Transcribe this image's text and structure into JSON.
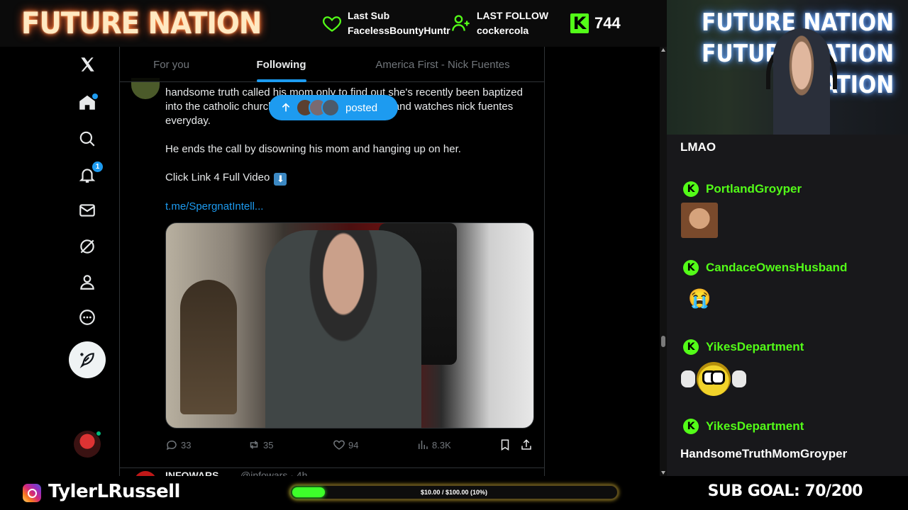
{
  "overlay": {
    "brand": "FUTURE NATION",
    "last_sub_label": "Last Sub",
    "last_sub_name": "FacelessBountyHuntr",
    "last_follow_label": "LAST FOLLOW",
    "last_follow_name": "cockercola",
    "kick_logo": "K",
    "viewer_count": "744",
    "accent_color": "#53fc18",
    "instagram_handle": "TylerLRussell",
    "goal_text": "$10.00 / $100.00 (10%)",
    "goal_progress_percent": 10,
    "sub_goal": "SUB GOAL: 70/200"
  },
  "webcam": {
    "neon_lines": [
      "FUTURE NATION",
      "FUTURE NATION",
      "NATION"
    ]
  },
  "x_app": {
    "nav_icons": [
      "x-logo-icon",
      "home-icon",
      "search-icon",
      "notifications-icon",
      "messages-icon",
      "grok-icon",
      "profile-icon",
      "more-icon",
      "post-icon"
    ],
    "notification_count": "1",
    "tabs": [
      {
        "label": "For you",
        "active": false
      },
      {
        "label": "Following",
        "active": true
      },
      {
        "label": "America First - Nick Fuentes",
        "active": false
      }
    ],
    "new_posts_pill": "posted",
    "tweet": {
      "line1": "handsome truth called his mom only to find out she's recently been baptized into the catholic church, repented for racist sins, and watches nick fuentes everyday.",
      "line2": "He ends the call by disowning his mom and hanging up on her.",
      "line3": "Click Link 4 Full Video",
      "link": "t.me/SpergnatIntell...",
      "replies": "33",
      "reposts": "35",
      "likes": "94",
      "views": "8.3K"
    },
    "next_tweet_name": "INFOWARS",
    "next_tweet_handle": "@infowars · 4h"
  },
  "chat": {
    "messages": [
      {
        "user": "",
        "text": "LMAO"
      },
      {
        "user": "PortlandGroyper",
        "text": ""
      },
      {
        "user": "CandaceOwensHusband",
        "text": "😭"
      },
      {
        "user": "YikesDepartment",
        "text": ""
      },
      {
        "user": "YikesDepartment",
        "text": "HandsomeTruthMomGroyper"
      }
    ]
  }
}
